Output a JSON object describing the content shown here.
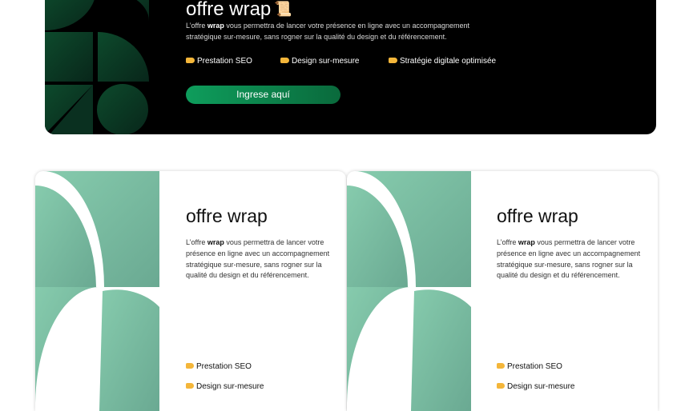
{
  "banner": {
    "title": "offre wrap",
    "title_icon": "scroll-icon",
    "desc_prefix": "L’offre ",
    "desc_bold": "wrap",
    "desc_suffix": " vous permettra de lancer votre présence en ligne avec un accompagnement stratégique sur-mesure, sans rogner sur la qualité du design et du référencement.",
    "features": [
      "Prestation SEO",
      "Design sur-mesure",
      "Stratégie digitale optimisée"
    ],
    "feature_icon": "pointing-hand-icon",
    "cta_label": "Ingrese aquí",
    "colors": {
      "background": "#000000",
      "accent": "#0e9d5c",
      "art_dark": "#0b3d24"
    }
  },
  "cards": [
    {
      "title": "offre wrap",
      "desc_prefix": "L’offre ",
      "desc_bold": "wrap",
      "desc_suffix": " vous permettra de lancer votre présence en ligne avec un accompagnement stratégique sur-mesure, sans rogner sur la qualité du design et du référencement.",
      "features": [
        "Prestation SEO",
        "Design sur-mesure"
      ]
    },
    {
      "title": "offre wrap",
      "desc_prefix": "L’offre ",
      "desc_bold": "wrap",
      "desc_suffix": " vous permettra de lancer votre présence en ligne avec un accompagnement stratégique sur-mesure, sans rogner sur la qualité du design et du référencement.",
      "features": [
        "Prestation SEO",
        "Design sur-mesure"
      ]
    }
  ],
  "colors": {
    "card_art": "#7ec4a6",
    "card_art_dark": "#6aa992"
  }
}
